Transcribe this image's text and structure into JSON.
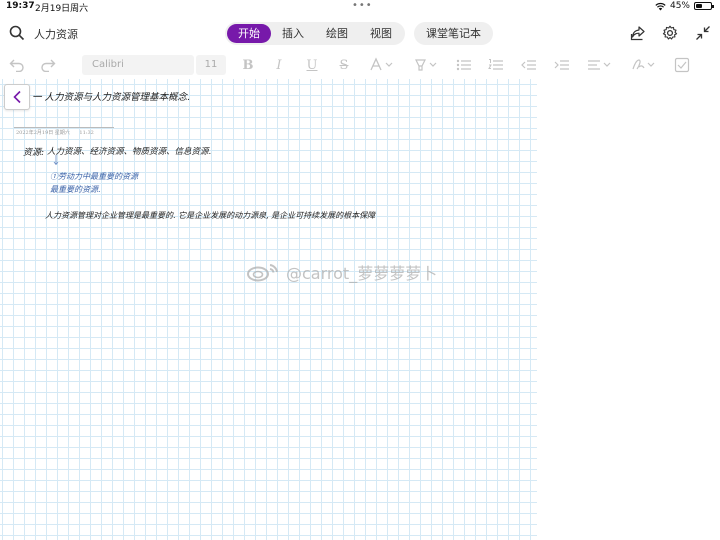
{
  "status": {
    "time": "19:37",
    "date": "2月19日周六",
    "dots": "•••",
    "battery": "45%",
    "battery_level": 0.45
  },
  "header": {
    "page_name": "人力资源",
    "tabs": [
      {
        "label": "开始",
        "active": true
      },
      {
        "label": "插入",
        "active": false
      },
      {
        "label": "绘图",
        "active": false
      },
      {
        "label": "视图",
        "active": false
      }
    ],
    "notebook_tab": "课堂笔记本"
  },
  "format_toolbar": {
    "font": "Calibri",
    "size": "11"
  },
  "note": {
    "line1": "一 人力资源与人力资源管理基本概念.",
    "meta_date": "2022年2月19日 星期六",
    "meta_time": "11:32",
    "resource_label": "资源:",
    "resource_list": "人力资源、经济资源、物质资源、信息资源.",
    "blue_note_1": "①劳动力中最重要的资源",
    "blue_note_2": "最重要的资源.",
    "paragraph": "人力资源管理对企业管理是最重要的.  它是企业发展的动力源泉,  是企业可持续发展的根本保障"
  },
  "watermark": "@carrot_萝萝萝萝卜",
  "colors": {
    "accent": "#7719aa",
    "grid": "#d5e9f5",
    "ink_blue": "#3a62a8"
  }
}
